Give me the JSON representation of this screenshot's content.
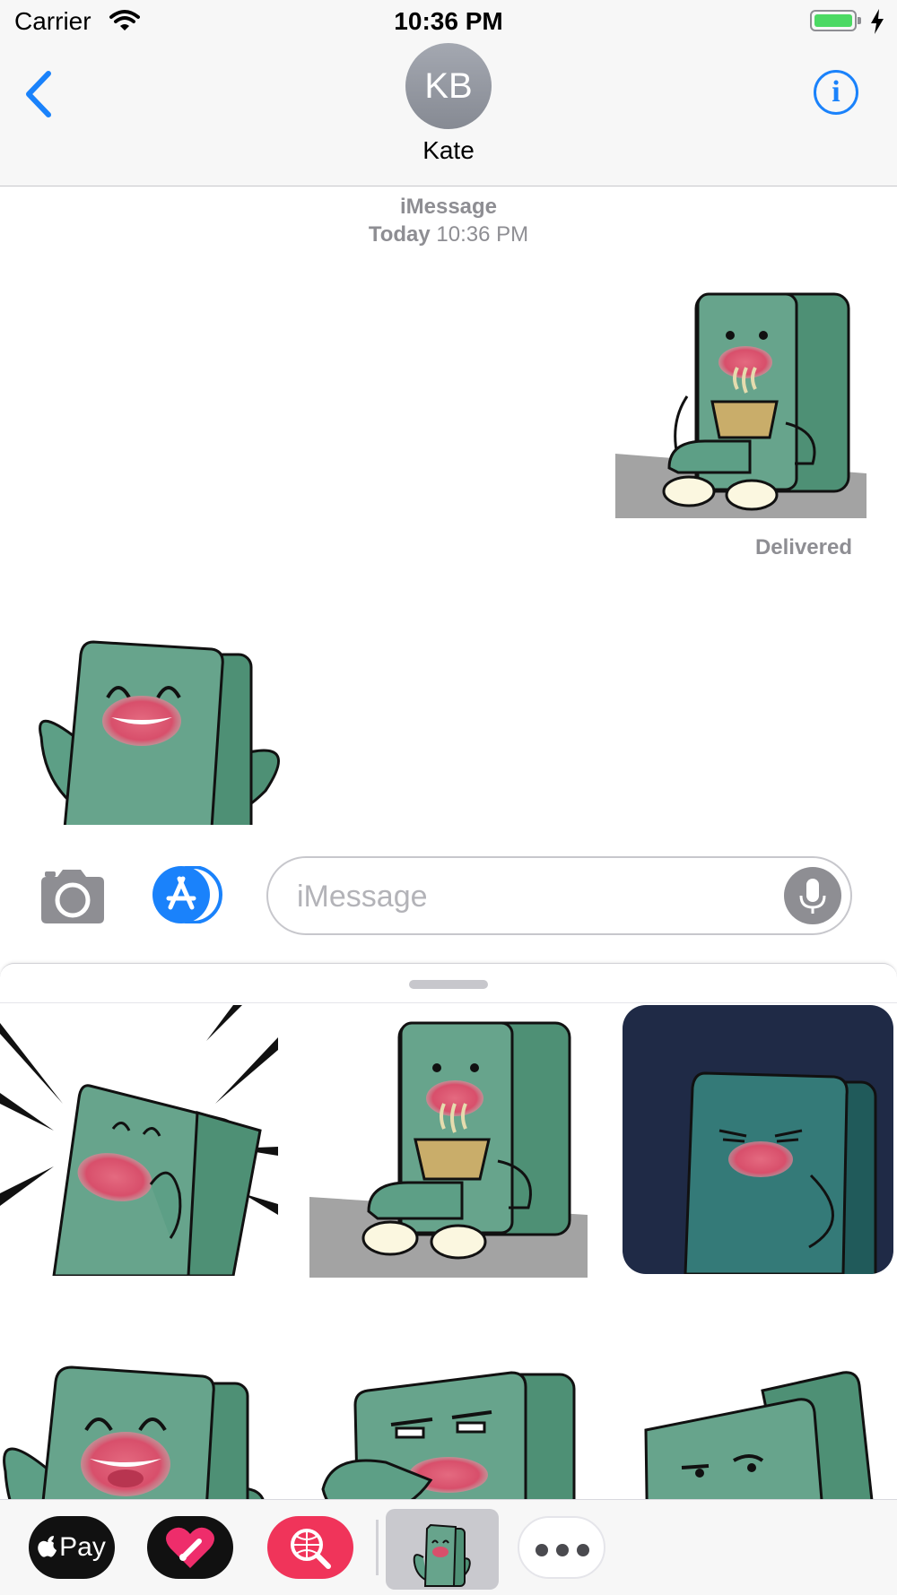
{
  "status_bar": {
    "carrier": "Carrier",
    "time": "10:36 PM",
    "battery": "full, charging"
  },
  "header": {
    "avatar_initials": "KB",
    "contact_name": "Kate",
    "info_glyph": "i",
    "back_icon": "chevron-left-icon"
  },
  "conversation": {
    "service": "iMessage",
    "date_label": "Today",
    "time_label": "10:36 PM",
    "delivered_label": "Delivered"
  },
  "compose": {
    "placeholder": "iMessage",
    "value": ""
  },
  "app_drawer": {
    "stickers": [
      "surprised-lips-sticker",
      "eating-noodles-sticker",
      "smug-night-sticker",
      "laughing-sticker",
      "suspicious-squint-sticker",
      "side-eye-sticker"
    ]
  },
  "app_strip": {
    "apple_pay_label": "Pay"
  },
  "colors": {
    "accent": "#1a82fb",
    "character": "#5d9f86",
    "night_bg": "#1f2a46",
    "pay_icon": "#f0345a"
  }
}
